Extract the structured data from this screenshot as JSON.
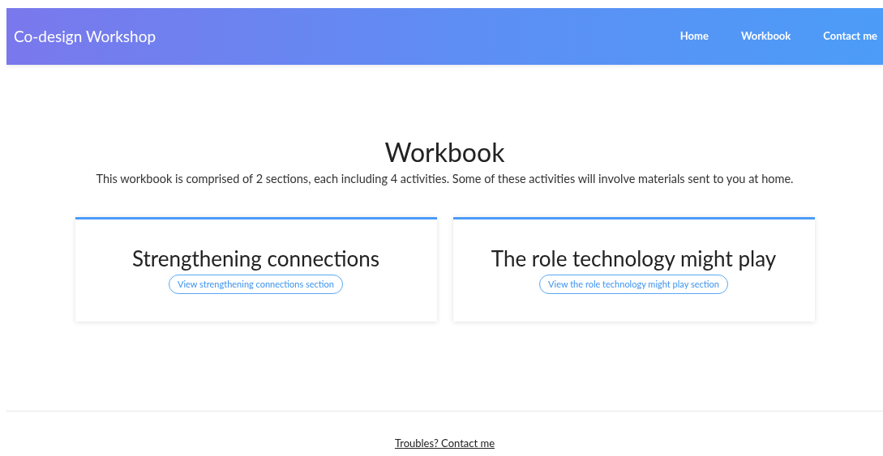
{
  "header": {
    "brand": "Co-design Workshop",
    "nav": [
      {
        "label": "Home"
      },
      {
        "label": "Workbook"
      },
      {
        "label": "Contact me"
      }
    ]
  },
  "main": {
    "title": "Workbook",
    "description": "This workbook is comprised of 2 sections, each including 4 activities. Some of these activities will involve materials sent to you at home.",
    "sections": [
      {
        "title": "Strengthening connections",
        "button": "View strengthening connections section"
      },
      {
        "title": "The role technology might play",
        "button": "View the role technology might play section"
      }
    ]
  },
  "footer": {
    "link": "Troubles? Contact me"
  }
}
